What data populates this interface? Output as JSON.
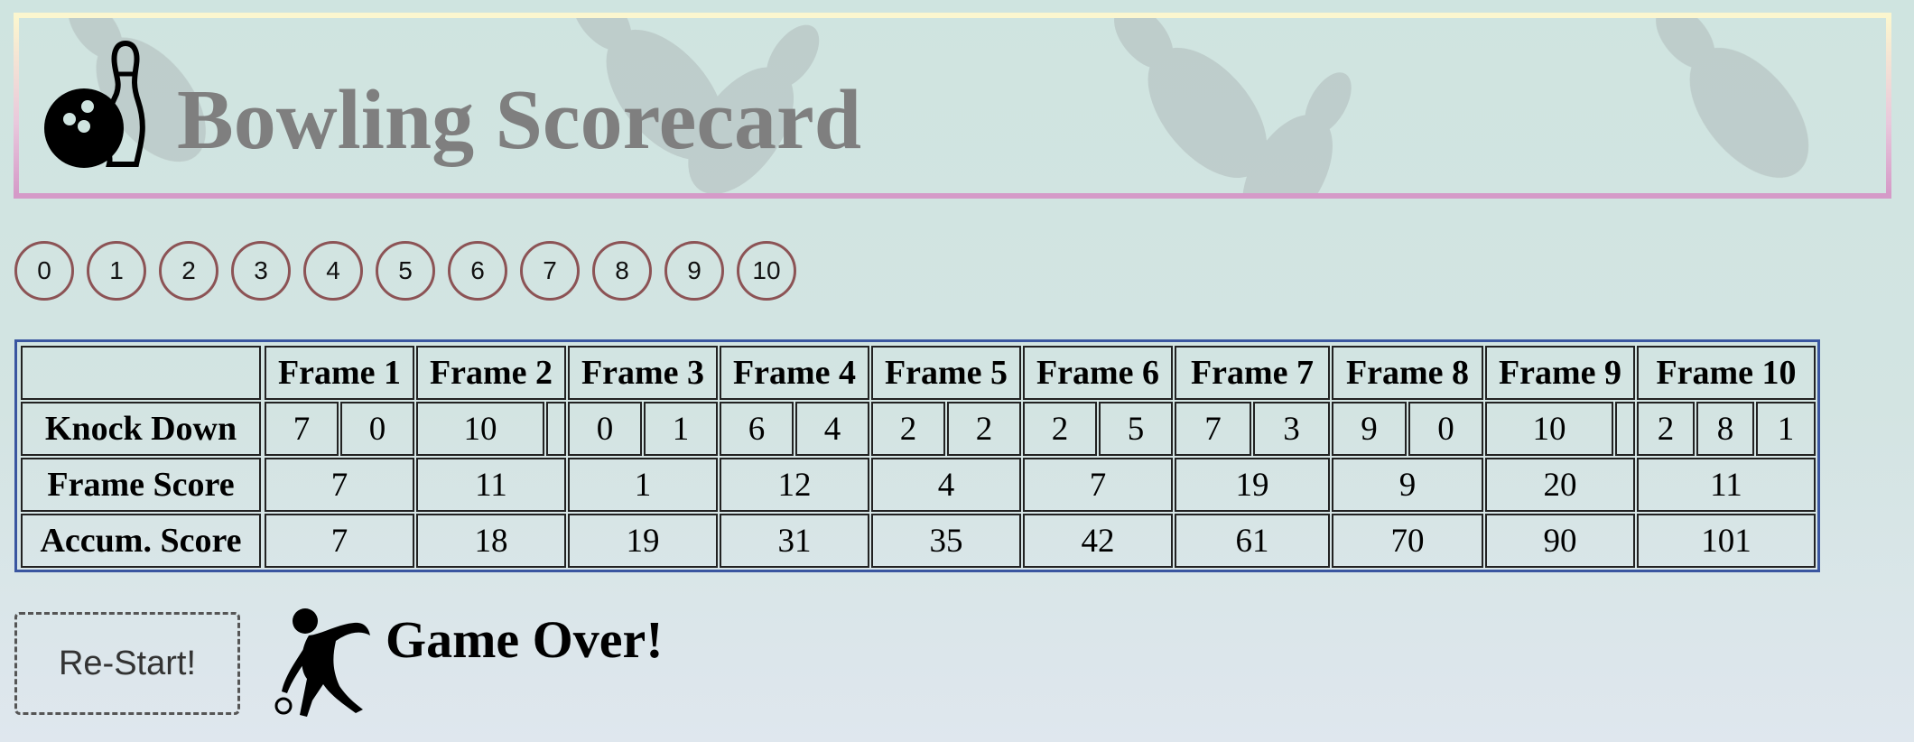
{
  "header": {
    "title": "Bowling Scorecard"
  },
  "pin_buttons": [
    "0",
    "1",
    "2",
    "3",
    "4",
    "5",
    "6",
    "7",
    "8",
    "9",
    "10"
  ],
  "table": {
    "frames": [
      "Frame 1",
      "Frame 2",
      "Frame 3",
      "Frame 4",
      "Frame 5",
      "Frame 6",
      "Frame 7",
      "Frame 8",
      "Frame 9",
      "Frame 10"
    ],
    "row_labels": {
      "knock_down": "Knock Down",
      "frame_score": "Frame Score",
      "accum_score": "Accum. Score"
    },
    "knock_down": [
      [
        "7",
        "0"
      ],
      [
        "10",
        ""
      ],
      [
        "0",
        "1"
      ],
      [
        "6",
        "4"
      ],
      [
        "2",
        "2"
      ],
      [
        "2",
        "5"
      ],
      [
        "7",
        "3"
      ],
      [
        "9",
        "0"
      ],
      [
        "10",
        ""
      ],
      [
        "2",
        "8",
        "1"
      ]
    ],
    "frame_score": [
      "7",
      "11",
      "1",
      "12",
      "4",
      "7",
      "19",
      "9",
      "20",
      "11"
    ],
    "accum_score": [
      "7",
      "18",
      "19",
      "31",
      "35",
      "42",
      "61",
      "70",
      "90",
      "101"
    ]
  },
  "footer": {
    "restart_label": "Re-Start!",
    "status": "Game Over!"
  },
  "colors": {
    "title": "#7f7f7f",
    "pin_button_border": "#8c5355",
    "table_border": "#3a56a0"
  },
  "icons": {
    "logo": "bowling-ball-and-pin-icon",
    "bowler": "bowler-icon"
  }
}
